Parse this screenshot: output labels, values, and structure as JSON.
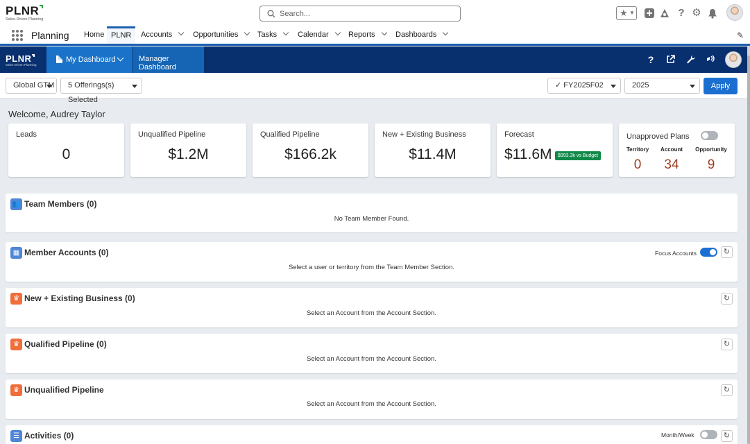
{
  "header": {
    "logo_text": "PLNR",
    "logo_tagline": "Sales-Driven Planning",
    "search_placeholder": "Search..."
  },
  "nav": {
    "app_name": "Planning",
    "items": [
      {
        "label": "Home",
        "dropdown": false
      },
      {
        "label": "PLNR",
        "dropdown": false,
        "active": true
      },
      {
        "label": "Accounts",
        "dropdown": true
      },
      {
        "label": "Opportunities",
        "dropdown": true
      },
      {
        "label": "Tasks",
        "dropdown": true
      },
      {
        "label": "Calendar",
        "dropdown": true
      },
      {
        "label": "Reports",
        "dropdown": true
      },
      {
        "label": "Dashboards",
        "dropdown": true
      }
    ]
  },
  "plnr_bar": {
    "logo_text": "PLNR",
    "logo_tagline": "Sales-Driven Planning",
    "tabs": [
      "My Dashboard",
      "Manager Dashboard"
    ]
  },
  "filters": {
    "region": "Global GTM",
    "offerings": "5 Offerings(s) Selected",
    "period": "✓ FY2025F02",
    "year": "2025",
    "apply_label": "Apply"
  },
  "welcome": "Welcome, Audrey Taylor",
  "kpis": [
    {
      "title": "Leads",
      "value": "0"
    },
    {
      "title": "Unqualified Pipeline",
      "value": "$1.2M"
    },
    {
      "title": "Qualified Pipeline",
      "value": "$166.2k"
    },
    {
      "title": "New + Existing Business",
      "value": "$11.4M"
    },
    {
      "title": "Forecast",
      "value": "$11.6M",
      "badge": "$993.3k vs Budget"
    }
  ],
  "unapproved": {
    "title": "Unapproved Plans",
    "columns": [
      "Territory",
      "Account",
      "Opportunity"
    ],
    "values": [
      "0",
      "34",
      "9"
    ],
    "toggle_on": false
  },
  "panels": {
    "team_members": {
      "title": "Team Members (0)",
      "message": "No Team Member Found."
    },
    "member_accounts": {
      "title": "Member Accounts (0)",
      "message": "Select a user or territory from the Team Member Section.",
      "toggle_label": "Focus Accounts",
      "toggle_on": true
    },
    "new_existing": {
      "title": "New + Existing Business (0)",
      "message": "Select an Account from the Account Section."
    },
    "qualified": {
      "title": "Qualified Pipeline (0)",
      "message": "Select an Account from the Account Section."
    },
    "unqualified": {
      "title": "Unqualified Pipeline",
      "message": "Select an Account from the Account Section."
    },
    "activities": {
      "title": "Activities (0)",
      "toggle_label": "Month/Week",
      "toggle_on": false
    }
  },
  "colors": {
    "brand_dark": "#082f6e",
    "tab_active": "#1a73c9",
    "apply_button": "#1b6fd0",
    "badge_green": "#118a49",
    "unapproved_value": "#9b3c22"
  }
}
